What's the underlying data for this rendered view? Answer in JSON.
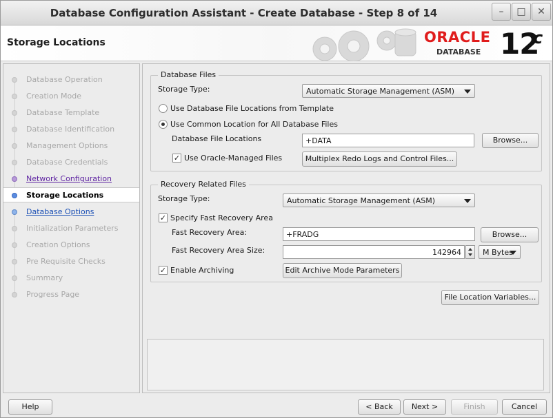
{
  "window": {
    "title": "Database Configuration Assistant - Create Database - Step 8 of 14",
    "controls": [
      "minimize",
      "maximize",
      "close"
    ]
  },
  "header": {
    "page_title": "Storage Locations",
    "logo": {
      "oracle": "ORACLE",
      "database": "DATABASE",
      "version": "12",
      "version_sup": "c"
    }
  },
  "steps": [
    {
      "label": "Database Operation",
      "state": "disabled"
    },
    {
      "label": "Creation Mode",
      "state": "disabled"
    },
    {
      "label": "Database Template",
      "state": "disabled"
    },
    {
      "label": "Database Identification",
      "state": "disabled"
    },
    {
      "label": "Management Options",
      "state": "disabled"
    },
    {
      "label": "Database Credentials",
      "state": "disabled"
    },
    {
      "label": "Network Configuration",
      "state": "done"
    },
    {
      "label": "Storage Locations",
      "state": "current"
    },
    {
      "label": "Database Options",
      "state": "next"
    },
    {
      "label": "Initialization Parameters",
      "state": "disabled"
    },
    {
      "label": "Creation Options",
      "state": "disabled"
    },
    {
      "label": "Pre Requisite Checks",
      "state": "disabled"
    },
    {
      "label": "Summary",
      "state": "disabled"
    },
    {
      "label": "Progress Page",
      "state": "disabled"
    }
  ],
  "db_files": {
    "legend": "Database Files",
    "storage_type_label": "Storage Type:",
    "storage_type_value": "Automatic Storage Management (ASM)",
    "radio_template": "Use Database File Locations from Template",
    "radio_common": "Use Common Location for All Database Files",
    "file_locations_label": "Database File Locations",
    "file_locations_value": "+DATA",
    "browse": "Browse...",
    "use_omf_label": "Use Oracle-Managed Files",
    "multiplex_button": "Multiplex Redo Logs and Control Files..."
  },
  "recovery": {
    "legend": "Recovery Related Files",
    "storage_type_label": "Storage Type:",
    "storage_type_value": "Automatic Storage Management (ASM)",
    "specify_fra_label": "Specify Fast Recovery Area",
    "fra_label": "Fast Recovery Area:",
    "fra_value": "+FRADG",
    "browse": "Browse...",
    "fra_size_label": "Fast Recovery Area Size:",
    "fra_size_value": "142964",
    "fra_size_unit": "M Bytes",
    "enable_archiving_label": "Enable Archiving",
    "archive_button": "Edit Archive Mode Parameters"
  },
  "file_location_variables": "File Location Variables...",
  "footer": {
    "help": "Help",
    "back": "< Back",
    "next": "Next >",
    "finish": "Finish",
    "cancel": "Cancel"
  }
}
